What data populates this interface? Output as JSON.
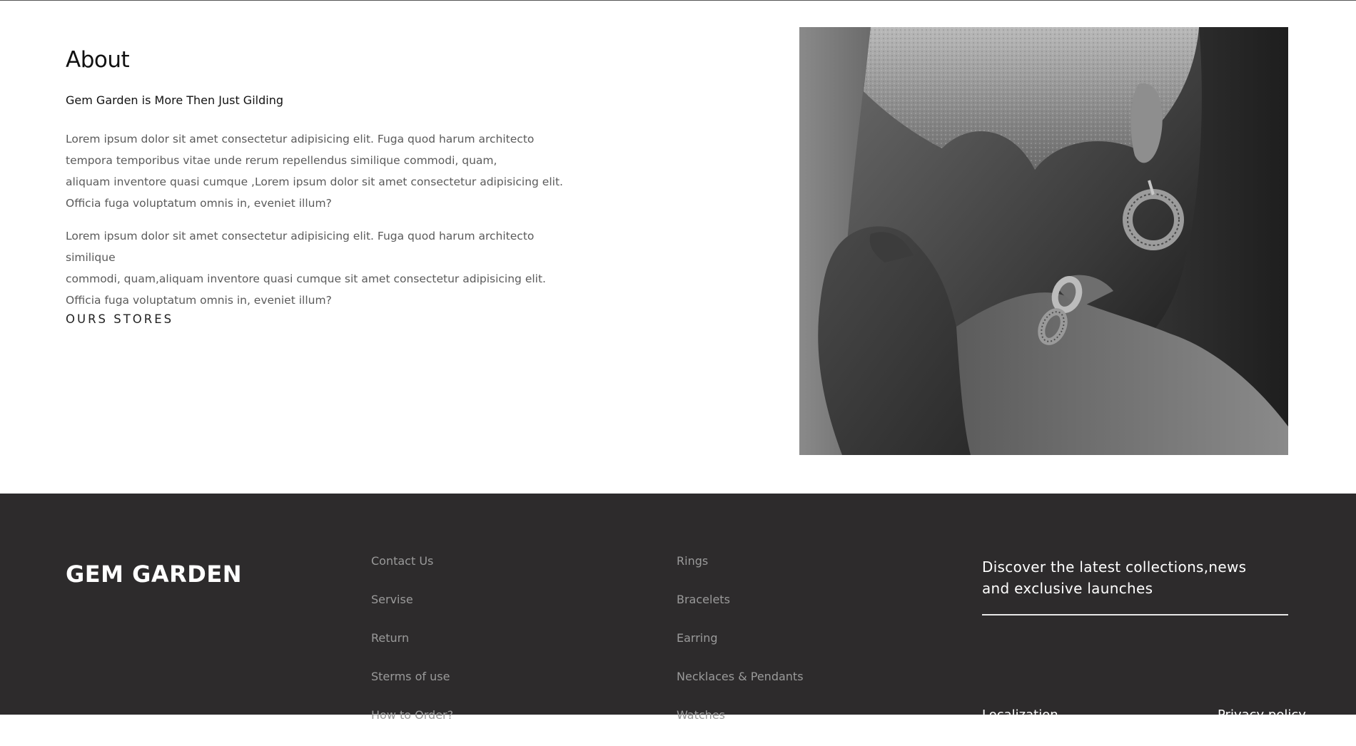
{
  "about": {
    "title": "About",
    "subtitle": "Gem Garden is More Then Just Gilding",
    "paragraph1": "Lorem ipsum dolor sit amet consectetur adipisicing elit. Fuga quod harum architecto\ntempora temporibus vitae unde rerum repellendus similique commodi, quam,\naliquam inventore quasi cumque ,Lorem ipsum dolor sit amet consectetur adipisicing elit.\nOfficia fuga voluptatum omnis in, eveniet illum?",
    "paragraph2": "Lorem ipsum dolor sit amet consectetur adipisicing elit. Fuga quod harum architecto similique\ncommodi, quam,aliquam inventore quasi cumque sit amet consectetur adipisicing elit.\nOfficia fuga voluptatum omnis in, eveniet illum?",
    "stores_link": "OURS STORES"
  },
  "footer": {
    "brand": "GEM GARDEN",
    "links_col1": [
      {
        "label": "Contact Us"
      },
      {
        "label": "Servise"
      },
      {
        "label": "Return"
      },
      {
        "label": "Sterms of use"
      },
      {
        "label": "How to Order?"
      }
    ],
    "links_col2": [
      {
        "label": "Rings"
      },
      {
        "label": "Bracelets"
      },
      {
        "label": "Earring"
      },
      {
        "label": "Necklaces & Pendants"
      },
      {
        "label": "Watches"
      }
    ],
    "newsletter_text": "Discover the latest collections,news and exclusive launches",
    "bottom_link_1": "Localization",
    "bottom_link_2": "Privacy policy"
  },
  "colors": {
    "footer_bg": "#2d2b2c",
    "body_text": "#5a5a5a",
    "footer_link": "#9a9a9a"
  }
}
